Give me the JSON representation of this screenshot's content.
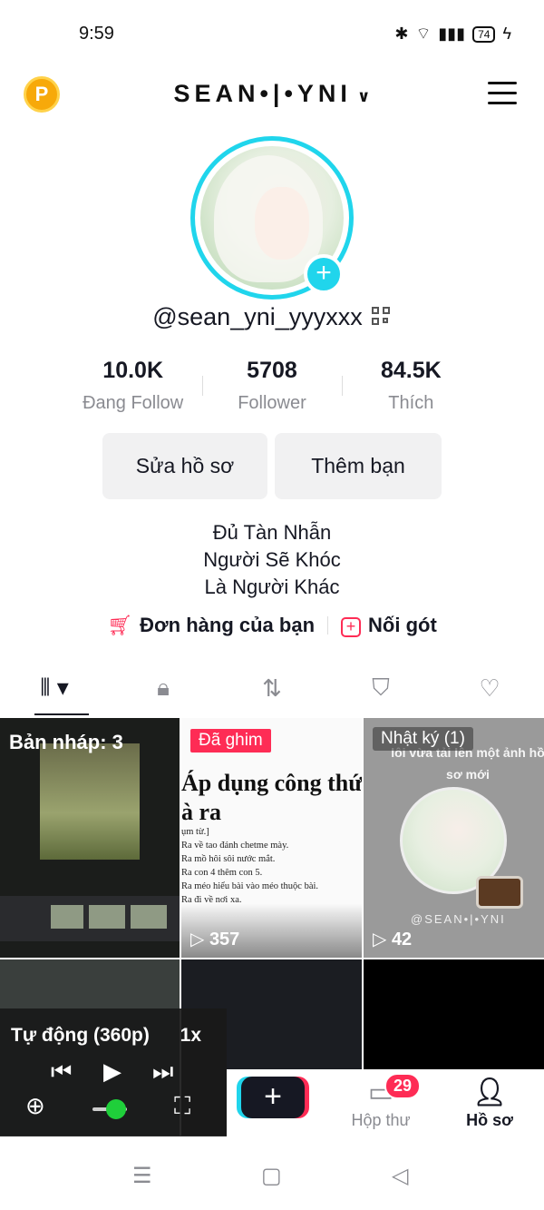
{
  "status_bar": {
    "time": "9:59",
    "battery": "74"
  },
  "header": {
    "coin_label": "P",
    "title": "SEAN•|•YNI"
  },
  "profile": {
    "handle": "@sean_yni_yyyxxx",
    "stats": [
      {
        "value": "10.0K",
        "label": "Đang Follow"
      },
      {
        "value": "5708",
        "label": "Follower"
      },
      {
        "value": "84.5K",
        "label": "Thích"
      }
    ],
    "buttons": {
      "edit": "Sửa hồ sơ",
      "add_friend": "Thêm bạn"
    },
    "bio": [
      "Đủ Tàn Nhẫn",
      "Người Sẽ Khóc",
      "Là Người Khác"
    ],
    "links": {
      "orders": "Đơn hàng của bạn",
      "noi_got": "Nối gót"
    }
  },
  "videos": {
    "draft_label": "Bản nháp: 3",
    "pinned": {
      "tag": "Đã ghim",
      "title_line1": "Áp dụng công thức",
      "title_line2": "à ra",
      "lines": [
        "ụm từ.]",
        "Ra về tao đánh chetme mày.",
        "Ra mồ hôi sôi nước mắt.",
        "Ra con 4 thêm con 5.",
        "Ra méo hiểu bài vào méo thuộc bài.",
        "Ra đi về nơi xa."
      ],
      "views": "357"
    },
    "diary": {
      "tag": "Nhật ký (1)",
      "caption": "lôi vừa tải lên một ảnh hồ sơ mới",
      "watermark": "@SEAN•|•YNI",
      "views": "42"
    }
  },
  "mini_player": {
    "quality": "Tự động (360p)",
    "speed": "1x"
  },
  "bottom_nav": {
    "inbox_label": "Hộp thư",
    "inbox_badge": "29",
    "profile_label": "Hồ sơ"
  },
  "colors": {
    "accent_pink": "#fe2c55",
    "accent_cyan": "#20d5ec",
    "text_primary": "#161823",
    "text_secondary": "#8a8b91"
  }
}
